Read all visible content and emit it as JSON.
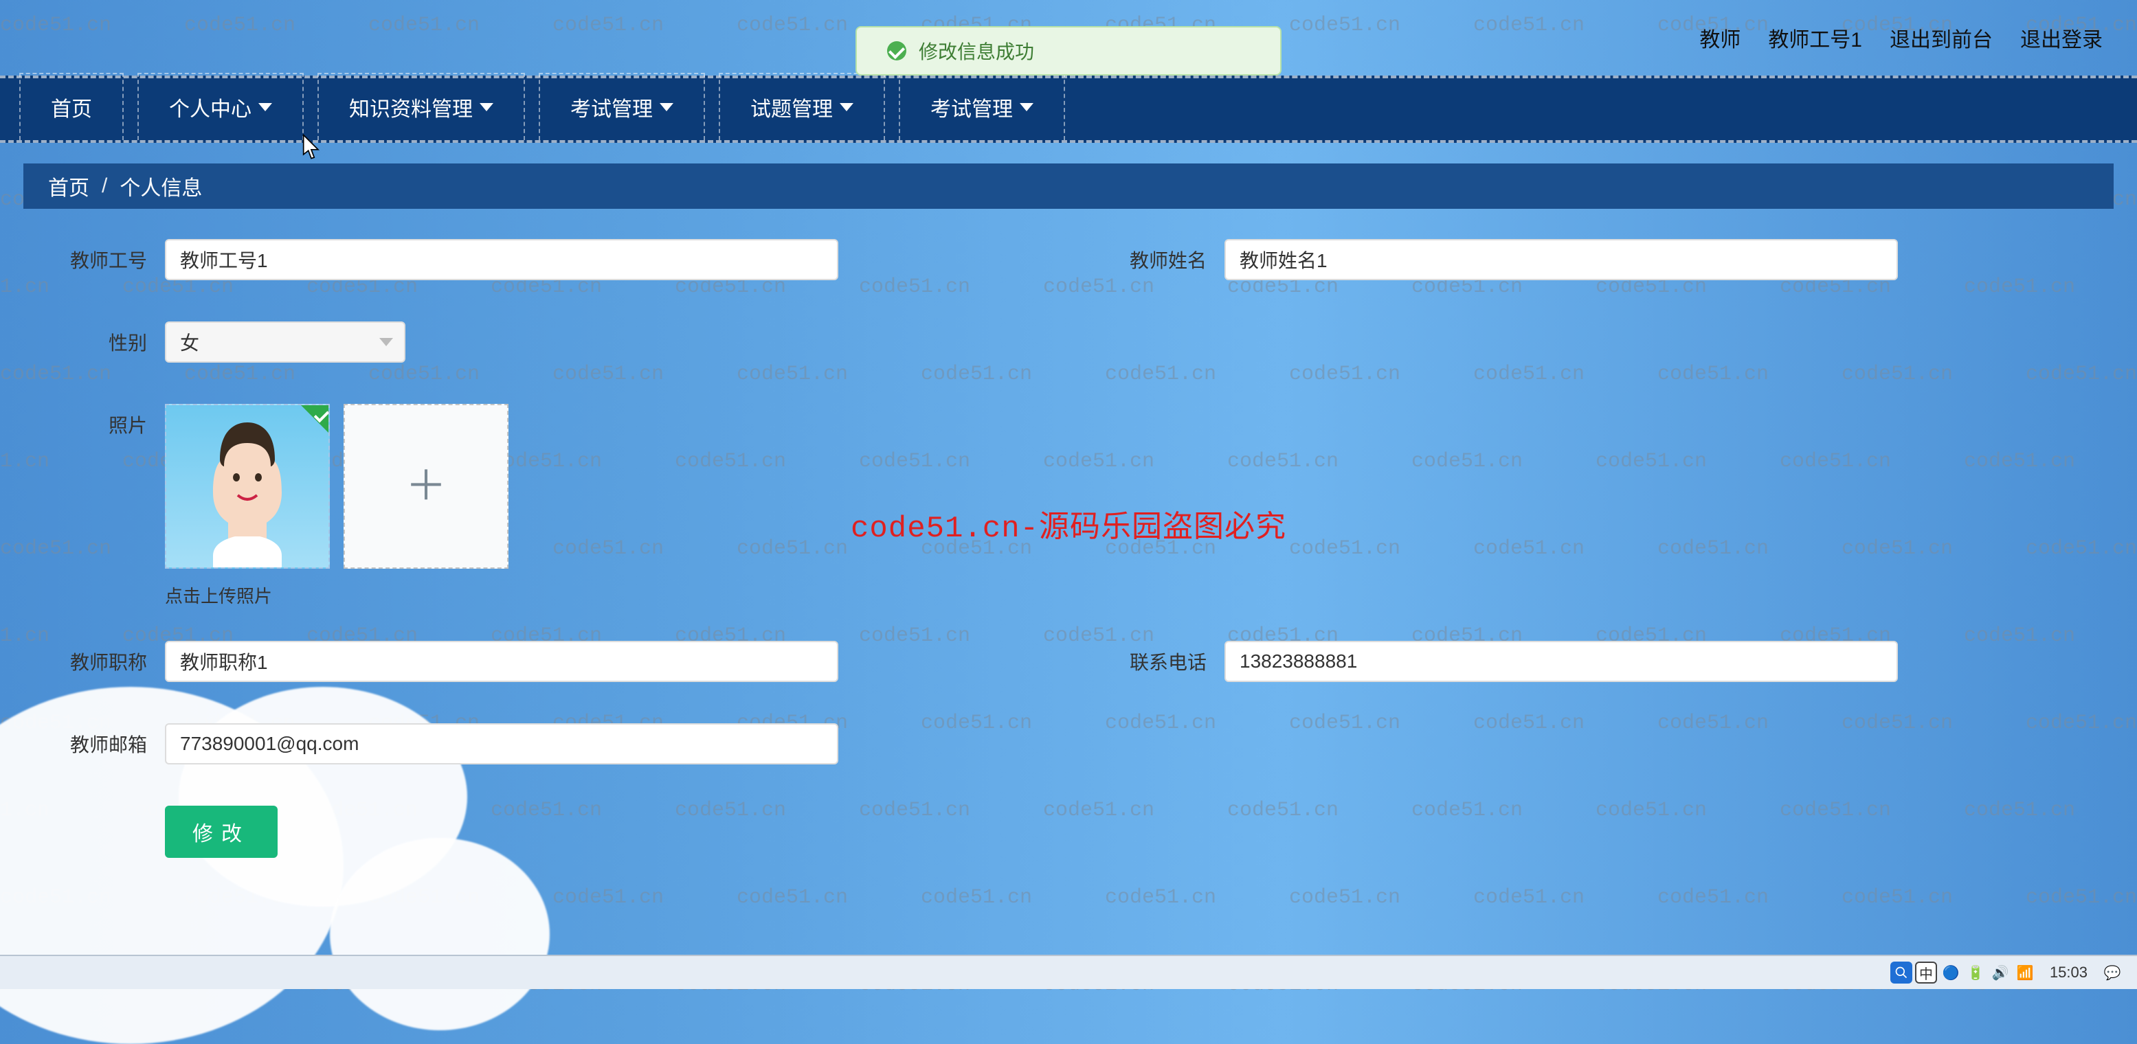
{
  "watermark_text": "code51.cn",
  "red_overlay_text": "code51.cn-源码乐园盗图必究",
  "toast": {
    "message": "修改信息成功"
  },
  "header": {
    "role": "教师",
    "uid": "教师工号1",
    "back_link": "退出到前台",
    "logout_link": "退出登录"
  },
  "menu": {
    "items": [
      {
        "label": "首页",
        "has_dropdown": false
      },
      {
        "label": "个人中心",
        "has_dropdown": true
      },
      {
        "label": "知识资料管理",
        "has_dropdown": true
      },
      {
        "label": "考试管理",
        "has_dropdown": true
      },
      {
        "label": "试题管理",
        "has_dropdown": true
      },
      {
        "label": "考试管理",
        "has_dropdown": true
      }
    ]
  },
  "breadcrumb": {
    "home": "首页",
    "sep": "/",
    "current": "个人信息"
  },
  "form": {
    "teacher_id_label": "教师工号",
    "teacher_id_value": "教师工号1",
    "teacher_name_label": "教师姓名",
    "teacher_name_value": "教师姓名1",
    "gender_label": "性别",
    "gender_value": "女",
    "photo_label": "照片",
    "photo_hint": "点击上传照片",
    "title_label": "教师职称",
    "title_value": "教师职称1",
    "phone_label": "联系电话",
    "phone_value": "13823888881",
    "email_label": "教师邮箱",
    "email_value": "773890001@qq.com",
    "submit_label": "修改"
  },
  "taskbar": {
    "ime": "中",
    "time": "15:03"
  }
}
